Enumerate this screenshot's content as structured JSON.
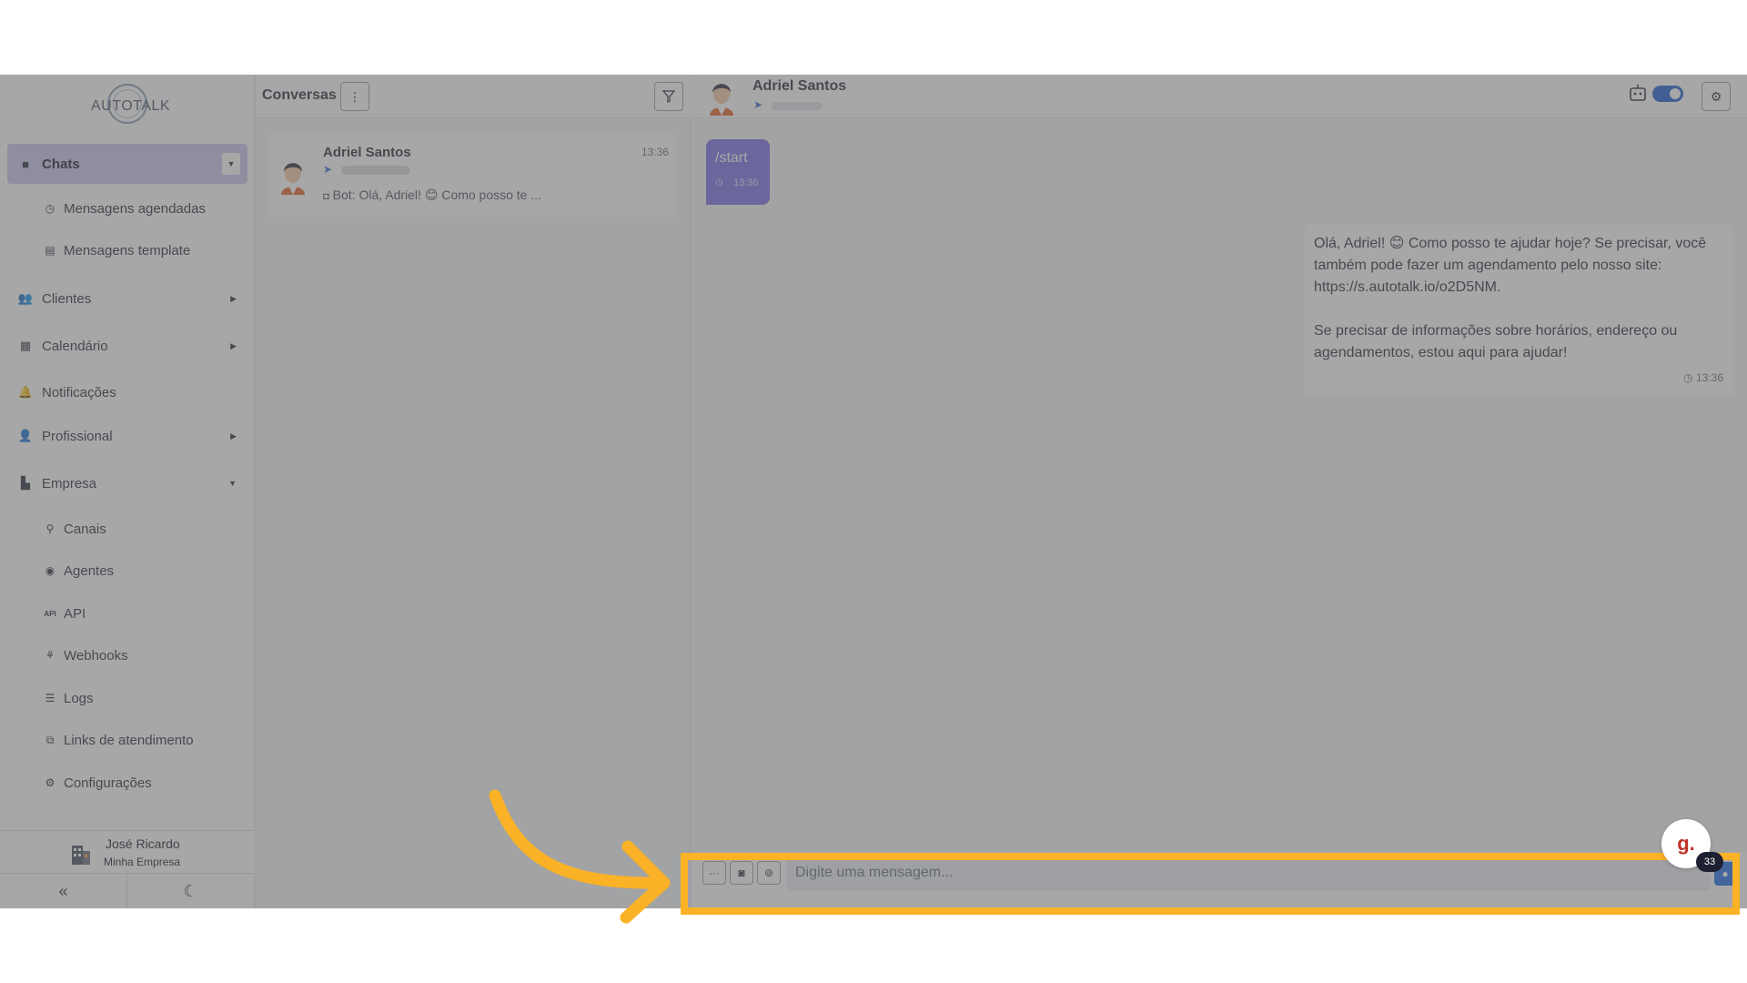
{
  "app": {
    "logo_text": "AUTOTALK"
  },
  "sidebar": {
    "items": [
      {
        "label": "Chats",
        "icon": "chat-icon",
        "active": true
      },
      {
        "label": "Mensagens agendadas",
        "icon": "clock-icon"
      },
      {
        "label": "Mensagens template",
        "icon": "template-icon"
      },
      {
        "label": "Clientes",
        "icon": "users-icon"
      },
      {
        "label": "Calendário",
        "icon": "calendar-icon"
      },
      {
        "label": "Notificações",
        "icon": "bell-icon"
      },
      {
        "label": "Profissional",
        "icon": "user-cog-icon"
      },
      {
        "label": "Empresa",
        "icon": "building-icon"
      },
      {
        "label": "Canais",
        "icon": "plug-icon"
      },
      {
        "label": "Agentes",
        "icon": "robot-icon"
      },
      {
        "label": "API",
        "icon": "api-icon"
      },
      {
        "label": "Webhooks",
        "icon": "webhook-icon"
      },
      {
        "label": "Logs",
        "icon": "list-icon"
      },
      {
        "label": "Links de atendimento",
        "icon": "external-link-icon"
      },
      {
        "label": "Configurações",
        "icon": "gear-icon"
      }
    ],
    "user": {
      "name": "José Ricardo",
      "org": "Minha Empresa"
    },
    "collapse_glyph": "«",
    "theme_glyph": "☾"
  },
  "conversations": {
    "title": "Conversas",
    "items": [
      {
        "name": "Adriel Santos",
        "time": "13:36",
        "preview": "Bot: Olá, Adriel! 😊 Como posso te ..."
      }
    ]
  },
  "chat": {
    "contact_name": "Adriel Santos",
    "messages": [
      {
        "from": "user",
        "text": "/start",
        "time": "13:36"
      },
      {
        "from": "bot",
        "lines": [
          "Olá, Adriel! 😊 Como posso te ajudar hoje? Se precisar, você",
          "também pode fazer um agendamento pelo nosso site:",
          "https://s.autotalk.io/o2D5NM.",
          "Se precisar de informações sobre horários, endereço ou",
          "agendamentos, estou aqui para ajudar!"
        ],
        "time": "13:36"
      }
    ],
    "composer": {
      "placeholder": "Digite uma mensagem...",
      "value": ""
    }
  },
  "overlay": {
    "fab_label": "g.",
    "badge_count": "33",
    "highlight_color": "#fbb226"
  }
}
